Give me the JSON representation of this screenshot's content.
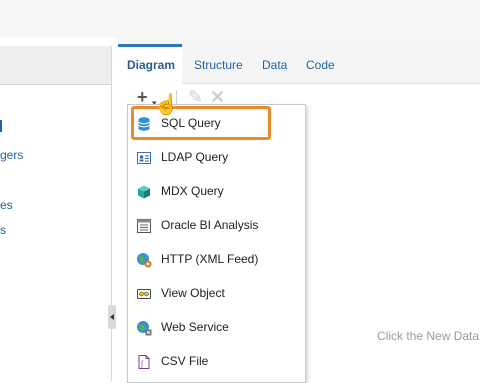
{
  "left_panel": {
    "links": [
      "gers",
      "es",
      "s"
    ]
  },
  "tabs": [
    {
      "label": "Diagram"
    },
    {
      "label": "Structure"
    },
    {
      "label": "Data"
    },
    {
      "label": "Code"
    }
  ],
  "toolbar": {
    "add_icon": "plus-icon",
    "dropdown_icon": "chevron-down-icon",
    "edit_icon": "pencil-icon",
    "delete_icon": "close-icon"
  },
  "menu": {
    "items": [
      {
        "label": "SQL Query",
        "icon": "database-icon"
      },
      {
        "label": "LDAP Query",
        "icon": "ldap-icon"
      },
      {
        "label": "MDX Query",
        "icon": "cube-icon"
      },
      {
        "label": "Oracle BI Analysis",
        "icon": "analysis-icon"
      },
      {
        "label": "HTTP (XML Feed)",
        "icon": "http-icon"
      },
      {
        "label": "View Object",
        "icon": "view-object-icon"
      },
      {
        "label": "Web Service",
        "icon": "web-service-icon"
      },
      {
        "label": "CSV File",
        "icon": "csv-file-icon"
      }
    ]
  },
  "main": {
    "empty_hint": "Click the New Data"
  },
  "colors": {
    "accent": "#2a79c0",
    "highlight": "#e98a2b",
    "link": "#1e63a5"
  }
}
